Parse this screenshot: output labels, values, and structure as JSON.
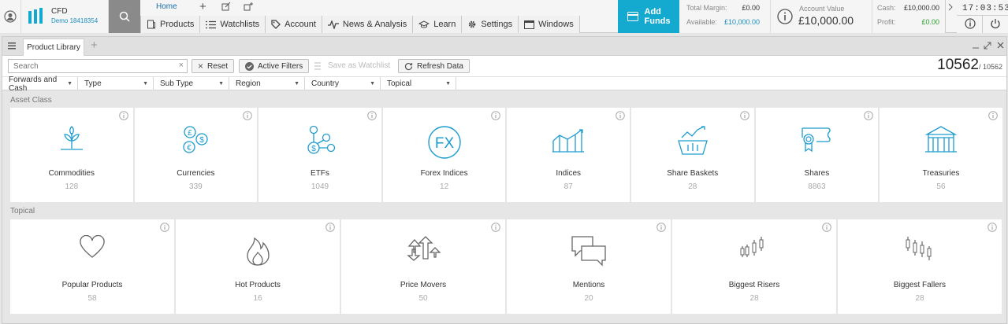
{
  "header": {
    "brand": {
      "name": "CFD",
      "account_label": "Demo 18418354"
    },
    "home_label": "Home",
    "nav": [
      {
        "label": "Products",
        "icon": "products-icon"
      },
      {
        "label": "Watchlists",
        "icon": "list-icon"
      },
      {
        "label": "Account",
        "icon": "tag-icon"
      },
      {
        "label": "News & Analysis",
        "icon": "pulse-icon"
      },
      {
        "label": "Learn",
        "icon": "mortarboard-icon"
      },
      {
        "label": "Settings",
        "icon": "gear-icon"
      },
      {
        "label": "Windows",
        "icon": "window-icon"
      }
    ],
    "add_funds": {
      "line1": "Add",
      "line2": "Funds"
    },
    "margin": {
      "total_label": "Total Margin:",
      "total_value": "£0.00",
      "available_label": "Available:",
      "available_value": "£10,000.00"
    },
    "account_value": {
      "label": "Account Value",
      "value": "£10,000.00"
    },
    "cash": {
      "label": "Cash:",
      "value": "£10,000.00",
      "profit_label": "Profit:",
      "profit_value": "£0.00"
    },
    "clock": "17:03:53",
    "colors": {
      "accent": "#14a9cf",
      "profit": "#2a9d2a",
      "available": "#1a8fc0"
    }
  },
  "panel": {
    "tab_label": "Product Library",
    "toolbar": {
      "search_placeholder": "Search",
      "reset_label": "Reset",
      "active_filters_label": "Active Filters",
      "save_watchlist_label": "Save as Watchlist",
      "refresh_label": "Refresh Data",
      "count_shown": "10562",
      "count_total": "/ 10562"
    },
    "filters": [
      "Forwards and Cash",
      "Type",
      "Sub Type",
      "Region",
      "Country",
      "Topical"
    ],
    "asset_class": {
      "title": "Asset Class",
      "cards": [
        {
          "label": "Commodities",
          "count": "128",
          "icon": "plant-icon"
        },
        {
          "label": "Currencies",
          "count": "339",
          "icon": "coins-icon"
        },
        {
          "label": "ETFs",
          "count": "1049",
          "icon": "etf-icon"
        },
        {
          "label": "Forex Indices",
          "count": "12",
          "icon": "fx-icon"
        },
        {
          "label": "Indices",
          "count": "87",
          "icon": "indices-chart-icon"
        },
        {
          "label": "Share Baskets",
          "count": "28",
          "icon": "basket-icon"
        },
        {
          "label": "Shares",
          "count": "8863",
          "icon": "certificate-icon"
        },
        {
          "label": "Treasuries",
          "count": "56",
          "icon": "treasury-building-icon"
        }
      ]
    },
    "topical": {
      "title": "Topical",
      "cards": [
        {
          "label": "Popular Products",
          "count": "58",
          "icon": "heart-icon"
        },
        {
          "label": "Hot Products",
          "count": "16",
          "icon": "flame-icon"
        },
        {
          "label": "Price Movers",
          "count": "50",
          "icon": "arrows-updown-icon"
        },
        {
          "label": "Mentions",
          "count": "20",
          "icon": "speech-bubbles-icon"
        },
        {
          "label": "Biggest Risers",
          "count": "28",
          "icon": "candles-up-icon"
        },
        {
          "label": "Biggest Fallers",
          "count": "28",
          "icon": "candles-down-icon"
        }
      ]
    }
  }
}
